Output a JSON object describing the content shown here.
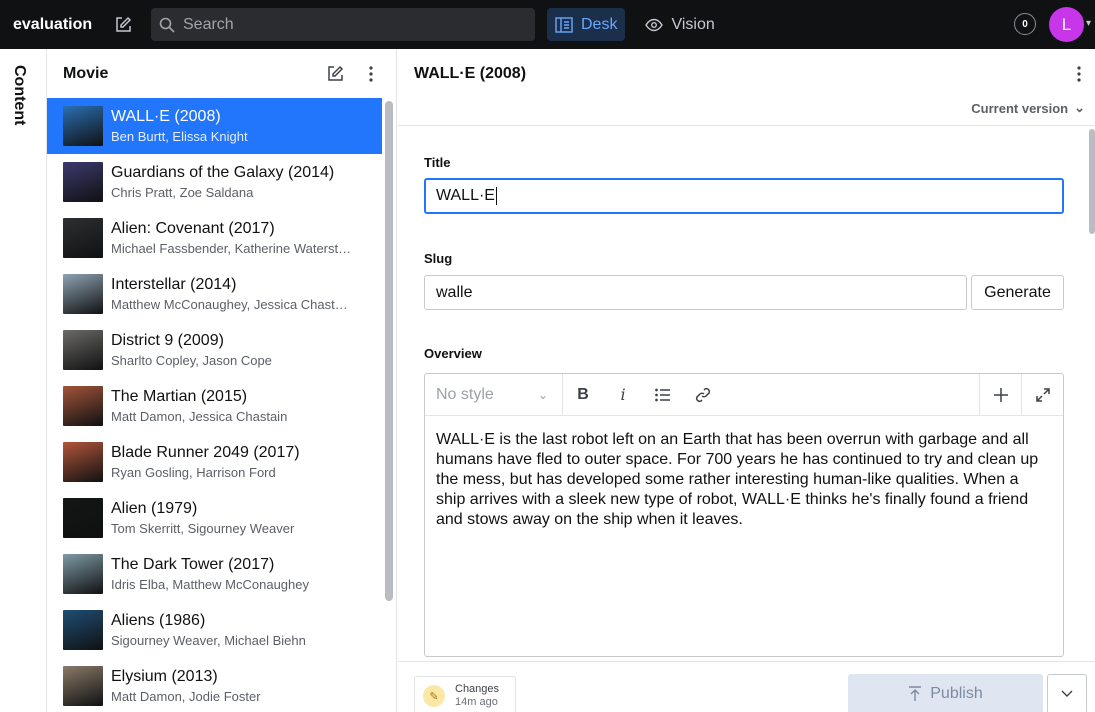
{
  "app": {
    "name": "evaluation",
    "search_placeholder": "Search",
    "tools": [
      {
        "label": "Desk",
        "icon": "desk-icon",
        "active": true
      },
      {
        "label": "Vision",
        "icon": "eye-icon",
        "active": false
      }
    ],
    "presence_count": "0",
    "user_initial": "L"
  },
  "rail": {
    "label": "Content"
  },
  "list": {
    "title": "Movie",
    "items": [
      {
        "title": "WALL·E (2008)",
        "subtitle": "Ben Burtt, Elissa Knight",
        "selected": true,
        "thumb": "#2a6fb3"
      },
      {
        "title": "Guardians of the Galaxy (2014)",
        "subtitle": "Chris Pratt, Zoe Saldana",
        "thumb": "#3c3a6e"
      },
      {
        "title": "Alien: Covenant (2017)",
        "subtitle": "Michael Fassbender, Katherine Waterst…",
        "thumb": "#2d2f30"
      },
      {
        "title": "Interstellar (2014)",
        "subtitle": "Matthew McConaughey, Jessica Chast…",
        "thumb": "#8fa3b2"
      },
      {
        "title": "District 9 (2009)",
        "subtitle": "Sharlto Copley, Jason Cope",
        "thumb": "#6b6a66"
      },
      {
        "title": "The Martian (2015)",
        "subtitle": "Matt Damon, Jessica Chastain",
        "thumb": "#a3543a"
      },
      {
        "title": "Blade Runner 2049 (2017)",
        "subtitle": "Ryan Gosling, Harrison Ford",
        "thumb": "#b2553a"
      },
      {
        "title": "Alien (1979)",
        "subtitle": "Tom Skerritt, Sigourney Weaver",
        "thumb": "#121614"
      },
      {
        "title": "The Dark Tower (2017)",
        "subtitle": "Idris Elba, Matthew McConaughey",
        "thumb": "#7f9aa5"
      },
      {
        "title": "Aliens (1986)",
        "subtitle": "Sigourney Weaver, Michael Biehn",
        "thumb": "#1f4d74"
      },
      {
        "title": "Elysium (2013)",
        "subtitle": "Matt Damon, Jodie Foster",
        "thumb": "#8b7a68"
      }
    ]
  },
  "document": {
    "title": "WALL·E (2008)",
    "version_label": "Current version",
    "fields": {
      "title_label": "Title",
      "title_value": "WALL·E",
      "slug_label": "Slug",
      "slug_value": "walle",
      "generate_label": "Generate",
      "overview_label": "Overview",
      "style_placeholder": "No style",
      "overview_text": "WALL·E is the last robot left on an Earth that has been overrun with garbage and all humans have fled to outer space. For 700 years he has continued to try and clean up the mess, but has developed some rather interesting human-like qualities. When a ship arrives with a sleek new type of robot, WALL·E thinks he's finally found a friend and stows away on the ship when it leaves."
    },
    "footer": {
      "changes_label": "Changes",
      "changes_ago": "14m ago",
      "publish_label": "Publish"
    }
  },
  "colors": {
    "accent": "#2276fc",
    "avatar": "#c736e8",
    "topbar": "#101112"
  }
}
